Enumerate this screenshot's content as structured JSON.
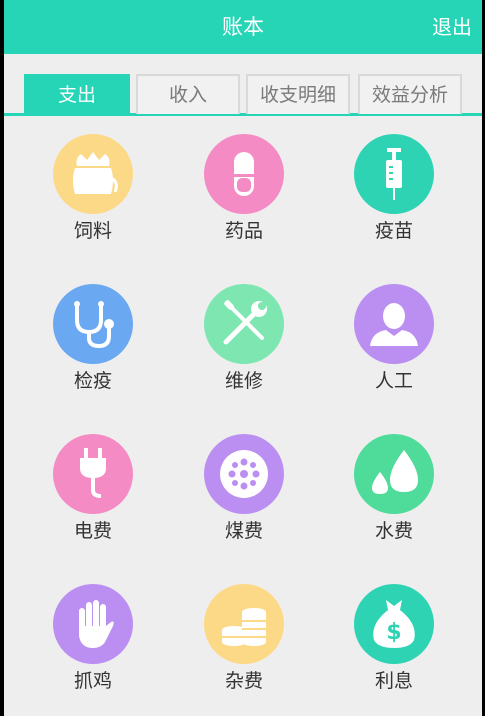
{
  "header": {
    "title": "账本",
    "logout_label": "退出",
    "color": "#26d4b6"
  },
  "tabs": [
    {
      "label": "支出",
      "active": true
    },
    {
      "label": "收入",
      "active": false
    },
    {
      "label": "收支明细",
      "active": false
    },
    {
      "label": "效益分析",
      "active": false
    }
  ],
  "categories": [
    {
      "label": "饲料",
      "icon": "feed-bag-icon",
      "color": "#fcd987"
    },
    {
      "label": "药品",
      "icon": "pill-icon",
      "color": "#f48bc4"
    },
    {
      "label": "疫苗",
      "icon": "syringe-icon",
      "color": "#2ed3b4"
    },
    {
      "label": "检疫",
      "icon": "stethoscope-icon",
      "color": "#6aa9f2"
    },
    {
      "label": "维修",
      "icon": "tools-icon",
      "color": "#7ee6b0"
    },
    {
      "label": "人工",
      "icon": "person-icon",
      "color": "#bb8ef1"
    },
    {
      "label": "电费",
      "icon": "plug-icon",
      "color": "#f48bc4"
    },
    {
      "label": "煤费",
      "icon": "coal-icon",
      "color": "#bb8ef1"
    },
    {
      "label": "水费",
      "icon": "water-drops-icon",
      "color": "#4fdc9a"
    },
    {
      "label": "抓鸡",
      "icon": "hand-icon",
      "color": "#bb8ef1"
    },
    {
      "label": "杂费",
      "icon": "coins-icon",
      "color": "#fcd987"
    },
    {
      "label": "利息",
      "icon": "money-bag-icon",
      "color": "#2ed3b4"
    }
  ]
}
